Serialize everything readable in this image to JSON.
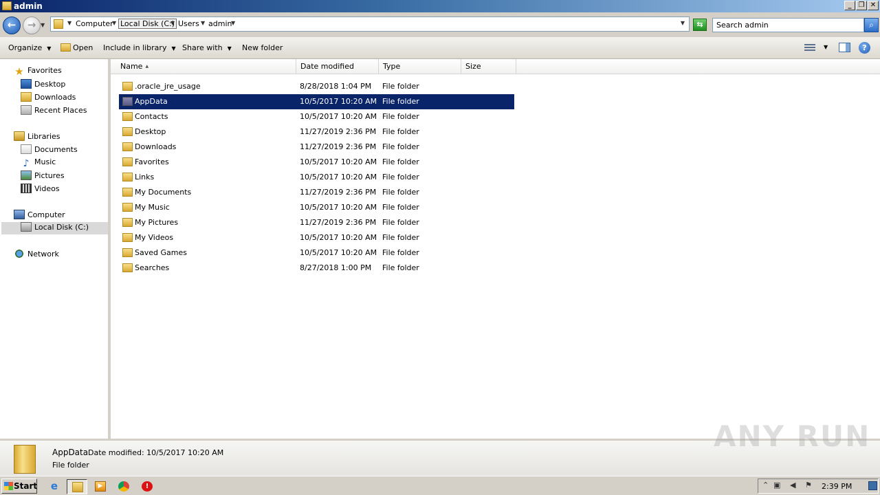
{
  "window": {
    "title": "admin"
  },
  "address": {
    "crumbs": [
      "Computer",
      "Local Disk (C:)",
      "Users",
      "admin"
    ]
  },
  "search": {
    "placeholder": "Search admin"
  },
  "toolbar": {
    "organize": "Organize",
    "open": "Open",
    "include_in_library": "Include in library",
    "share_with": "Share with",
    "new_folder": "New folder"
  },
  "nav": {
    "favorites": {
      "label": "Favorites",
      "items": [
        "Desktop",
        "Downloads",
        "Recent Places"
      ]
    },
    "libraries": {
      "label": "Libraries",
      "items": [
        "Documents",
        "Music",
        "Pictures",
        "Videos"
      ]
    },
    "computer": {
      "label": "Computer",
      "items": [
        "Local Disk (C:)"
      ]
    },
    "network": {
      "label": "Network"
    }
  },
  "columns": [
    "Name",
    "Date modified",
    "Type",
    "Size"
  ],
  "files": [
    {
      "name": ".oracle_jre_usage",
      "date": "8/28/2018 1:04 PM",
      "type": "File folder"
    },
    {
      "name": "AppData",
      "date": "10/5/2017 10:20 AM",
      "type": "File folder",
      "selected": true
    },
    {
      "name": "Contacts",
      "date": "10/5/2017 10:20 AM",
      "type": "File folder"
    },
    {
      "name": "Desktop",
      "date": "11/27/2019 2:36 PM",
      "type": "File folder"
    },
    {
      "name": "Downloads",
      "date": "11/27/2019 2:36 PM",
      "type": "File folder"
    },
    {
      "name": "Favorites",
      "date": "10/5/2017 10:20 AM",
      "type": "File folder"
    },
    {
      "name": "Links",
      "date": "10/5/2017 10:20 AM",
      "type": "File folder"
    },
    {
      "name": "My Documents",
      "date": "11/27/2019 2:36 PM",
      "type": "File folder"
    },
    {
      "name": "My Music",
      "date": "10/5/2017 10:20 AM",
      "type": "File folder"
    },
    {
      "name": "My Pictures",
      "date": "11/27/2019 2:36 PM",
      "type": "File folder"
    },
    {
      "name": "My Videos",
      "date": "10/5/2017 10:20 AM",
      "type": "File folder"
    },
    {
      "name": "Saved Games",
      "date": "10/5/2017 10:20 AM",
      "type": "File folder"
    },
    {
      "name": "Searches",
      "date": "8/27/2018 1:00 PM",
      "type": "File folder"
    }
  ],
  "details": {
    "name": "AppData",
    "date_modified": "Date modified: 10/5/2017 10:20 AM",
    "type": "File folder"
  },
  "watermark": "ANY RUN",
  "taskbar": {
    "start": "Start",
    "clock": "2:39 PM"
  }
}
